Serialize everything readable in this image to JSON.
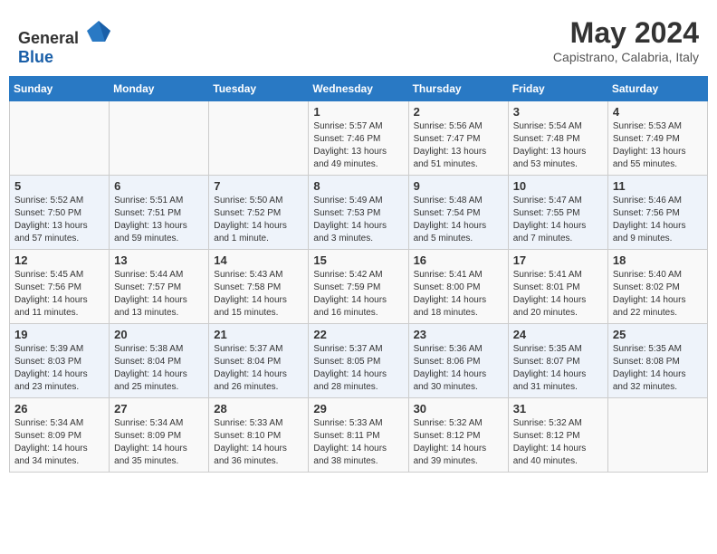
{
  "header": {
    "logo_general": "General",
    "logo_blue": "Blue",
    "month": "May 2024",
    "location": "Capistrano, Calabria, Italy"
  },
  "weekdays": [
    "Sunday",
    "Monday",
    "Tuesday",
    "Wednesday",
    "Thursday",
    "Friday",
    "Saturday"
  ],
  "weeks": [
    [
      {
        "day": "",
        "info": ""
      },
      {
        "day": "",
        "info": ""
      },
      {
        "day": "",
        "info": ""
      },
      {
        "day": "1",
        "info": "Sunrise: 5:57 AM\nSunset: 7:46 PM\nDaylight: 13 hours\nand 49 minutes."
      },
      {
        "day": "2",
        "info": "Sunrise: 5:56 AM\nSunset: 7:47 PM\nDaylight: 13 hours\nand 51 minutes."
      },
      {
        "day": "3",
        "info": "Sunrise: 5:54 AM\nSunset: 7:48 PM\nDaylight: 13 hours\nand 53 minutes."
      },
      {
        "day": "4",
        "info": "Sunrise: 5:53 AM\nSunset: 7:49 PM\nDaylight: 13 hours\nand 55 minutes."
      }
    ],
    [
      {
        "day": "5",
        "info": "Sunrise: 5:52 AM\nSunset: 7:50 PM\nDaylight: 13 hours\nand 57 minutes."
      },
      {
        "day": "6",
        "info": "Sunrise: 5:51 AM\nSunset: 7:51 PM\nDaylight: 13 hours\nand 59 minutes."
      },
      {
        "day": "7",
        "info": "Sunrise: 5:50 AM\nSunset: 7:52 PM\nDaylight: 14 hours\nand 1 minute."
      },
      {
        "day": "8",
        "info": "Sunrise: 5:49 AM\nSunset: 7:53 PM\nDaylight: 14 hours\nand 3 minutes."
      },
      {
        "day": "9",
        "info": "Sunrise: 5:48 AM\nSunset: 7:54 PM\nDaylight: 14 hours\nand 5 minutes."
      },
      {
        "day": "10",
        "info": "Sunrise: 5:47 AM\nSunset: 7:55 PM\nDaylight: 14 hours\nand 7 minutes."
      },
      {
        "day": "11",
        "info": "Sunrise: 5:46 AM\nSunset: 7:56 PM\nDaylight: 14 hours\nand 9 minutes."
      }
    ],
    [
      {
        "day": "12",
        "info": "Sunrise: 5:45 AM\nSunset: 7:56 PM\nDaylight: 14 hours\nand 11 minutes."
      },
      {
        "day": "13",
        "info": "Sunrise: 5:44 AM\nSunset: 7:57 PM\nDaylight: 14 hours\nand 13 minutes."
      },
      {
        "day": "14",
        "info": "Sunrise: 5:43 AM\nSunset: 7:58 PM\nDaylight: 14 hours\nand 15 minutes."
      },
      {
        "day": "15",
        "info": "Sunrise: 5:42 AM\nSunset: 7:59 PM\nDaylight: 14 hours\nand 16 minutes."
      },
      {
        "day": "16",
        "info": "Sunrise: 5:41 AM\nSunset: 8:00 PM\nDaylight: 14 hours\nand 18 minutes."
      },
      {
        "day": "17",
        "info": "Sunrise: 5:41 AM\nSunset: 8:01 PM\nDaylight: 14 hours\nand 20 minutes."
      },
      {
        "day": "18",
        "info": "Sunrise: 5:40 AM\nSunset: 8:02 PM\nDaylight: 14 hours\nand 22 minutes."
      }
    ],
    [
      {
        "day": "19",
        "info": "Sunrise: 5:39 AM\nSunset: 8:03 PM\nDaylight: 14 hours\nand 23 minutes."
      },
      {
        "day": "20",
        "info": "Sunrise: 5:38 AM\nSunset: 8:04 PM\nDaylight: 14 hours\nand 25 minutes."
      },
      {
        "day": "21",
        "info": "Sunrise: 5:37 AM\nSunset: 8:04 PM\nDaylight: 14 hours\nand 26 minutes."
      },
      {
        "day": "22",
        "info": "Sunrise: 5:37 AM\nSunset: 8:05 PM\nDaylight: 14 hours\nand 28 minutes."
      },
      {
        "day": "23",
        "info": "Sunrise: 5:36 AM\nSunset: 8:06 PM\nDaylight: 14 hours\nand 30 minutes."
      },
      {
        "day": "24",
        "info": "Sunrise: 5:35 AM\nSunset: 8:07 PM\nDaylight: 14 hours\nand 31 minutes."
      },
      {
        "day": "25",
        "info": "Sunrise: 5:35 AM\nSunset: 8:08 PM\nDaylight: 14 hours\nand 32 minutes."
      }
    ],
    [
      {
        "day": "26",
        "info": "Sunrise: 5:34 AM\nSunset: 8:09 PM\nDaylight: 14 hours\nand 34 minutes."
      },
      {
        "day": "27",
        "info": "Sunrise: 5:34 AM\nSunset: 8:09 PM\nDaylight: 14 hours\nand 35 minutes."
      },
      {
        "day": "28",
        "info": "Sunrise: 5:33 AM\nSunset: 8:10 PM\nDaylight: 14 hours\nand 36 minutes."
      },
      {
        "day": "29",
        "info": "Sunrise: 5:33 AM\nSunset: 8:11 PM\nDaylight: 14 hours\nand 38 minutes."
      },
      {
        "day": "30",
        "info": "Sunrise: 5:32 AM\nSunset: 8:12 PM\nDaylight: 14 hours\nand 39 minutes."
      },
      {
        "day": "31",
        "info": "Sunrise: 5:32 AM\nSunset: 8:12 PM\nDaylight: 14 hours\nand 40 minutes."
      },
      {
        "day": "",
        "info": ""
      }
    ]
  ]
}
